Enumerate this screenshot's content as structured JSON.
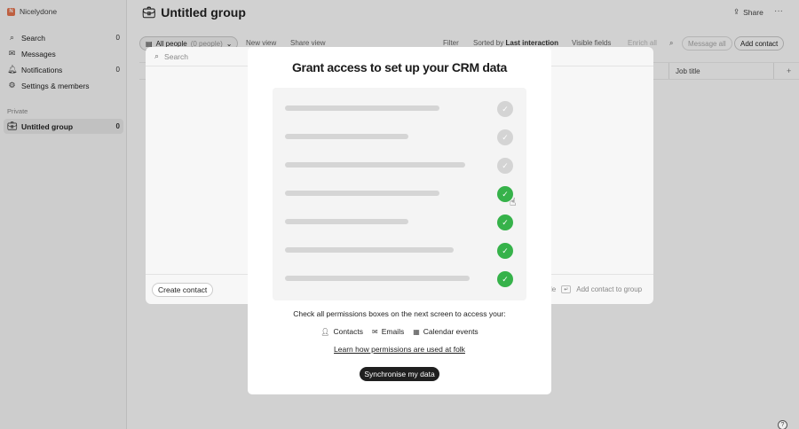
{
  "workspace": {
    "name": "Nicelydone",
    "logo_letter": "N"
  },
  "sidebar": {
    "items": [
      {
        "label": "Search",
        "icon": "search-icon",
        "count": "0"
      },
      {
        "label": "Messages",
        "icon": "mail-icon",
        "count": ""
      },
      {
        "label": "Notifications",
        "icon": "bell-icon",
        "count": "0"
      },
      {
        "label": "Settings & members",
        "icon": "gear-icon",
        "count": ""
      }
    ],
    "section_label": "Private",
    "group": {
      "label": "Untitled group",
      "icon": "briefcase-icon",
      "count": "0"
    }
  },
  "header": {
    "title": "Untitled group",
    "share_label": "Share",
    "more_label": "···"
  },
  "toolbar": {
    "view_label": "All people",
    "view_count": "(0 people)",
    "new_view": "New view",
    "share_view": "Share view",
    "filter": "Filter",
    "sorted_prefix": "Sorted by",
    "sorted_value": "Last interaction",
    "visible_fields": "Visible fields",
    "enrich_all": "Enrich all",
    "message_all": "Message all",
    "add_contact": "Add contact"
  },
  "table": {
    "col_job_title": "Job title"
  },
  "search_panel": {
    "placeholder": "Search",
    "create_contact": "Create contact",
    "footer_hint_1": "le",
    "footer_hint_2": "Add contact to group"
  },
  "modal": {
    "title": "Grant access to set up your CRM data",
    "permissions_text": "Check all permissions boxes on the next screen to access your:",
    "permissions": [
      {
        "label": "Contacts",
        "icon": "person-icon"
      },
      {
        "label": "Emails",
        "icon": "envelope-icon"
      },
      {
        "label": "Calendar events",
        "icon": "calendar-icon"
      }
    ],
    "learn_link": "Learn how permissions are used at folk",
    "sync_button": "Synchronise my data",
    "checklist_checked": [
      false,
      false,
      false,
      true,
      true,
      true,
      true
    ]
  },
  "colors": {
    "accent_green": "#36b24a",
    "button_dark": "#1f1f1f"
  }
}
